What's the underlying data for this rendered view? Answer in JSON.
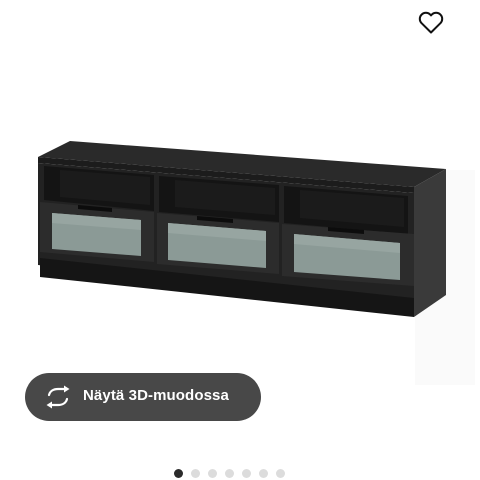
{
  "favorite": {
    "icon": "heart-outline-icon"
  },
  "product_image": {
    "subject": "tv-bench-black-brown"
  },
  "view_3d": {
    "label": "Näytä 3D-muodossa",
    "icon": "rotate-arrows-icon"
  },
  "carousel": {
    "total": 7,
    "active_index": 0
  },
  "colors": {
    "button_bg": "#484848",
    "dot_active": "#2b2b2b",
    "dot_inactive": "#dcdcdc"
  }
}
